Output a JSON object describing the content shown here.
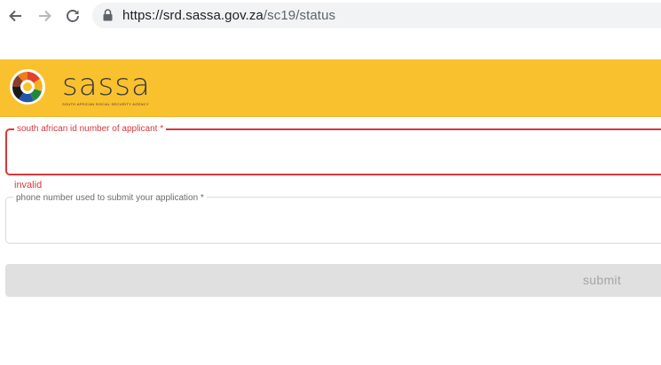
{
  "browser": {
    "url_host": "https://srd.sassa.gov.za",
    "url_path": "/sc19/status"
  },
  "header": {
    "brand": "sassa",
    "brand_subtitle": "SOUTH AFRICAN SOCIAL SECURITY AGENCY",
    "colors": {
      "background": "#fac12f"
    }
  },
  "form": {
    "id_field": {
      "label": "south african id number of applicant *",
      "value": "",
      "error": "invalid"
    },
    "phone_field": {
      "label": "phone number used to submit your application *",
      "value": ""
    },
    "submit_label": "submit"
  },
  "icons": [
    "back-icon",
    "forward-icon",
    "reload-icon",
    "lock-icon",
    "sassa-logo-icon"
  ],
  "colors": {
    "error": "#d9373a",
    "disabled_button": "#e0e0e0"
  }
}
